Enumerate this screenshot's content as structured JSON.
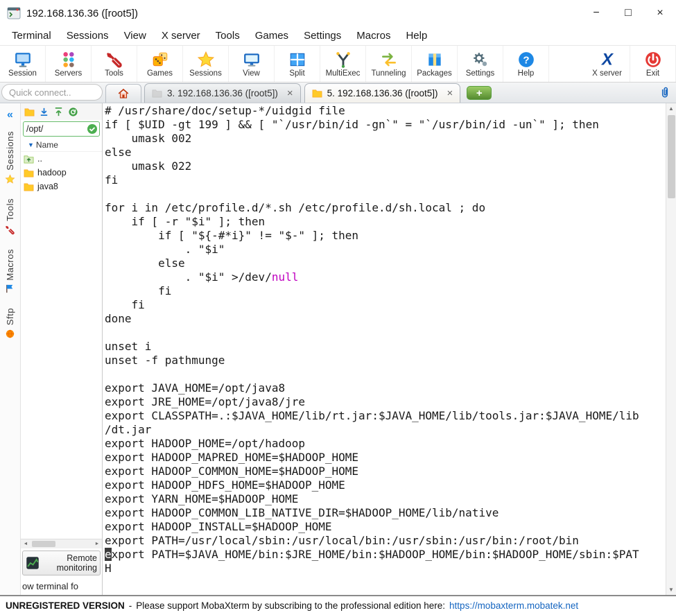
{
  "window": {
    "title": "192.168.136.36 ([root5])",
    "controls": {
      "minimize": "−",
      "maximize": "□",
      "close": "×"
    }
  },
  "menu": {
    "items": [
      "Terminal",
      "Sessions",
      "View",
      "X server",
      "Tools",
      "Games",
      "Settings",
      "Macros",
      "Help"
    ]
  },
  "toolbar": {
    "items": [
      {
        "label": "Session",
        "icon": "session-icon"
      },
      {
        "label": "Servers",
        "icon": "servers-icon"
      },
      {
        "label": "Tools",
        "icon": "tools-icon"
      },
      {
        "label": "Games",
        "icon": "games-icon"
      },
      {
        "label": "Sessions",
        "icon": "sessions-star-icon"
      },
      {
        "label": "View",
        "icon": "view-icon"
      },
      {
        "label": "Split",
        "icon": "split-icon"
      },
      {
        "label": "MultiExec",
        "icon": "multiexec-icon"
      },
      {
        "label": "Tunneling",
        "icon": "tunneling-icon"
      },
      {
        "label": "Packages",
        "icon": "packages-icon"
      },
      {
        "label": "Settings",
        "icon": "settings-icon"
      },
      {
        "label": "Help",
        "icon": "help-icon"
      },
      {
        "label": "X server",
        "icon": "xserver-icon",
        "group": "right"
      },
      {
        "label": "Exit",
        "icon": "exit-icon",
        "group": "right"
      }
    ]
  },
  "tabbar": {
    "quick_connect_placeholder": "Quick connect..",
    "home_tab_icon": "home-icon",
    "tabs": [
      {
        "label": "3. 192.168.136.36 ([root5])",
        "active": false,
        "icon": "folder-icon"
      },
      {
        "label": "5. 192.168.136.36 ([root5])",
        "active": true,
        "icon": "folder-icon"
      }
    ],
    "new_tab_label": "+",
    "attach_icon": "paperclip-icon"
  },
  "sidebar": {
    "collapse_icon": "double-chevron-left-icon",
    "collapse_glyph": "«",
    "vertical_tabs": [
      {
        "label": "Sessions",
        "icon": "star-icon"
      },
      {
        "label": "Tools",
        "icon": "wrench-icon"
      },
      {
        "label": "Macros",
        "icon": "flag-icon"
      },
      {
        "label": "Sftp",
        "icon": "globe-icon"
      }
    ],
    "file_panel": {
      "toolbar_icons": [
        "folder-icon",
        "download-icon",
        "upload-icon",
        "refresh-icon"
      ],
      "path": "/opt/",
      "path_ok_icon": "check-icon",
      "column_header": "Name",
      "entries": [
        {
          "name": "..",
          "icon": "folder-up-icon"
        },
        {
          "name": "hadoop",
          "icon": "folder-icon"
        },
        {
          "name": "java8",
          "icon": "folder-icon"
        }
      ],
      "remote_monitoring_label": "Remote monitoring",
      "follow_terminal_text": "ow terminal fo"
    }
  },
  "terminal": {
    "lines": [
      [
        {
          "t": "# /usr/share/doc/setup-*/uidgid file"
        }
      ],
      [
        {
          "t": "if [ $UID -gt 199 ] && [ \"`/usr/bin/id -gn`\" = \"`/usr/bin/id -un`\" ]; then"
        }
      ],
      [
        {
          "t": "    umask 002"
        }
      ],
      [
        {
          "t": "else"
        }
      ],
      [
        {
          "t": "    umask 022"
        }
      ],
      [
        {
          "t": "fi"
        }
      ],
      [],
      [
        {
          "t": "for i in /etc/profile.d/*.sh /etc/profile.d/sh.local ; do"
        }
      ],
      [
        {
          "t": "    if [ -r \"$i\" ]; then"
        }
      ],
      [
        {
          "t": "        if [ \"${-#*i}\" != \"$-\" ]; then"
        }
      ],
      [
        {
          "t": "            . \"$i\""
        }
      ],
      [
        {
          "t": "        else"
        }
      ],
      [
        {
          "t": "            . \"$i\" >/dev/"
        },
        {
          "t": "null",
          "c": "m"
        }
      ],
      [
        {
          "t": "        fi"
        }
      ],
      [
        {
          "t": "    fi"
        }
      ],
      [
        {
          "t": "done"
        }
      ],
      [],
      [
        {
          "t": "unset i"
        }
      ],
      [
        {
          "t": "unset -f pathmunge"
        }
      ],
      [],
      [
        {
          "t": "export JAVA_HOME=/opt/java8"
        }
      ],
      [
        {
          "t": "export JRE_HOME=/opt/java8/jre"
        }
      ],
      [
        {
          "t": "export CLASSPATH=.:$JAVA_HOME/lib/rt.jar:$JAVA_HOME/lib/tools.jar:$JAVA_HOME/lib"
        }
      ],
      [
        {
          "t": "/dt.jar"
        }
      ],
      [
        {
          "t": "export HADOOP_HOME=/opt/hadoop"
        }
      ],
      [
        {
          "t": "export HADOOP_MAPRED_HOME=$HADOOP_HOME"
        }
      ],
      [
        {
          "t": "export HADOOP_COMMON_HOME=$HADOOP_HOME"
        }
      ],
      [
        {
          "t": "export HADOOP_HDFS_HOME=$HADOOP_HOME"
        }
      ],
      [
        {
          "t": "export YARN_HOME=$HADOOP_HOME"
        }
      ],
      [
        {
          "t": "export HADOOP_COMMON_LIB_NATIVE_DIR=$HADOOP_HOME/lib/native"
        }
      ],
      [
        {
          "t": "export HADOOP_INSTALL=$HADOOP_HOME"
        }
      ],
      [
        {
          "t": "export PATH=/usr/local/sbin:/usr/local/bin:/usr/sbin:/usr/bin:/root/bin"
        }
      ],
      [
        {
          "t": "e",
          "cursor": true
        },
        {
          "t": "xport PATH=$JAVA_HOME/bin:$JRE_HOME/bin:$HADOOP_HOME/bin:$HADOOP_HOME/sbin:$PAT"
        }
      ],
      [
        {
          "t": "H"
        }
      ]
    ]
  },
  "statusbar": {
    "version_label": "UNREGISTERED VERSION",
    "separator": "-",
    "message": "Please support MobaXterm by subscribing to the professional edition here:",
    "link": "https://mobaxterm.mobatek.net"
  },
  "colors": {
    "syntax_magenta": "#c000c0",
    "link_blue": "#1565c0",
    "accent_green": "#4caf50",
    "tab_bar_bg": "#e9ebee"
  }
}
